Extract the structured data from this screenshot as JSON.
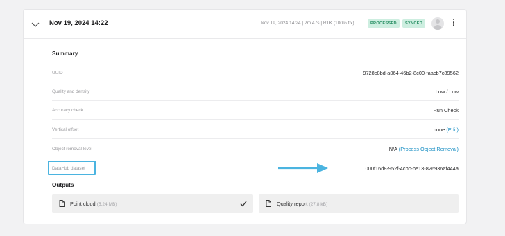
{
  "header": {
    "title": "Nov 19, 2024 14:22",
    "meta": "Nov 19, 2024 14:24 | 2m 47s | RTK (100% fix)",
    "badges": {
      "processed": "PROCESSED",
      "synced": "SYNCED"
    },
    "accent_color": "#1f8a5d"
  },
  "summary": {
    "title": "Summary",
    "rows": [
      {
        "label": "UUID",
        "value": "9728c8bd-a064-46b2-8c00-faacb7c89562"
      },
      {
        "label": "Quality and density",
        "value": "Low / Low"
      },
      {
        "label": "Accuracy check",
        "value": "Run Check"
      },
      {
        "label": "Vertical offset",
        "value": "none",
        "link": "(Edit)"
      },
      {
        "label": "Object removal level",
        "value": "N/A",
        "link": "(Process Object Removal)"
      },
      {
        "label": "DataHub dataset",
        "value": "000f16d8-952f-4cbc-be13-826936af444a"
      }
    ]
  },
  "outputs": {
    "title": "Outputs",
    "items": [
      {
        "name": "Point cloud",
        "size": "(5.24 MB)",
        "icon": "file-icon",
        "status_icon": "check-icon"
      },
      {
        "name": "Quality report",
        "size": "(27.8 kB)",
        "icon": "file-icon"
      }
    ]
  },
  "colors": {
    "link": "#1a8fc4",
    "highlight": "#4bb4e0",
    "badge_bg": "#cdeee0"
  }
}
